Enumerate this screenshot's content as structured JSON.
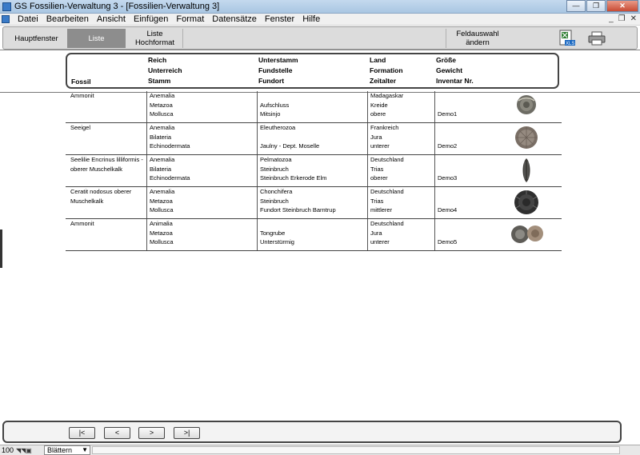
{
  "window": {
    "title": "GS Fossilien-Verwaltung 3 - [Fossilien-Verwaltung 3]"
  },
  "menu": [
    "Datei",
    "Bearbeiten",
    "Ansicht",
    "Einfügen",
    "Format",
    "Datensätze",
    "Fenster",
    "Hilfe"
  ],
  "toolbar": {
    "hauptfenster": "Hauptfenster",
    "liste": "Liste",
    "liste_hochformat_1": "Liste",
    "liste_hochformat_2": "Hochformat",
    "feldauswahl_1": "Feldauswahl",
    "feldauswahl_2": "ändern",
    "xls_label": "XLS"
  },
  "header": {
    "fossil": "Fossil",
    "reich": "Reich",
    "unterreich": "Unterreich",
    "stamm": "Stamm",
    "unterstamm": "Unterstamm",
    "fundstelle": "Fundstelle",
    "fundort": "Fundort",
    "land": "Land",
    "formation": "Formation",
    "zeitalter": "Zeitalter",
    "groesse": "Größe",
    "gewicht": "Gewicht",
    "inventar": "Inventar Nr."
  },
  "records": [
    {
      "fossil": "Ammonit",
      "reich": "Anemalia",
      "unterreich": "Metazoa",
      "stamm": "Mollusca",
      "unterstamm": "",
      "fundstelle": "Aufschluss",
      "fundort": "Mitsinjo",
      "land": "Madagaskar",
      "formation": "Kreide",
      "zeitalter": "obere",
      "inventar": "Demo1"
    },
    {
      "fossil": "Seeigel",
      "reich": "Anemalia",
      "unterreich": "Bilateria",
      "stamm": "Echinodermata",
      "unterstamm": "Eleutherozoa",
      "fundstelle": "",
      "fundort": "Jaulny - Dept. Moselle",
      "land": "Frankreich",
      "formation": "Jura",
      "zeitalter": "unterer",
      "inventar": "Demo2"
    },
    {
      "fossil": "Seelilie Encrinus lilliformis - oberer Muschelkalk",
      "reich": "Anemalia",
      "unterreich": "Bilateria",
      "stamm": "Echinodermata",
      "unterstamm": "Pelmatozoa",
      "fundstelle": "Steinbruch",
      "fundort": "Steinbruch Erkerode Elm",
      "land": "Deutschland",
      "formation": "Trias",
      "zeitalter": "oberer",
      "inventar": "Demo3"
    },
    {
      "fossil": "Ceratit nodosus oberer Muschelkalk",
      "reich": "Anemalia",
      "unterreich": "Metazoa",
      "stamm": "Mollusca",
      "unterstamm": "Chonchifera",
      "fundstelle": "Steinbruch",
      "fundort": "Fundort  Steinbruch Barntrup",
      "land": "Deutschland",
      "formation": "Trias",
      "zeitalter": "mittlerer",
      "inventar": "Demo4"
    },
    {
      "fossil": "Ammonit",
      "reich": "Animalia",
      "unterreich": "Metazoa",
      "stamm": "Mollusca",
      "unterstamm": "",
      "fundstelle": "Tongrube",
      "fundort": "Unterstürmig",
      "land": "Deutschland",
      "formation": "Jura",
      "zeitalter": "unterer",
      "inventar": "Demo5"
    }
  ],
  "nav": {
    "first": "|<",
    "prev": "<",
    "next": ">",
    "last": ">|"
  },
  "status": {
    "zoom": "100",
    "mode": "Blättern"
  }
}
